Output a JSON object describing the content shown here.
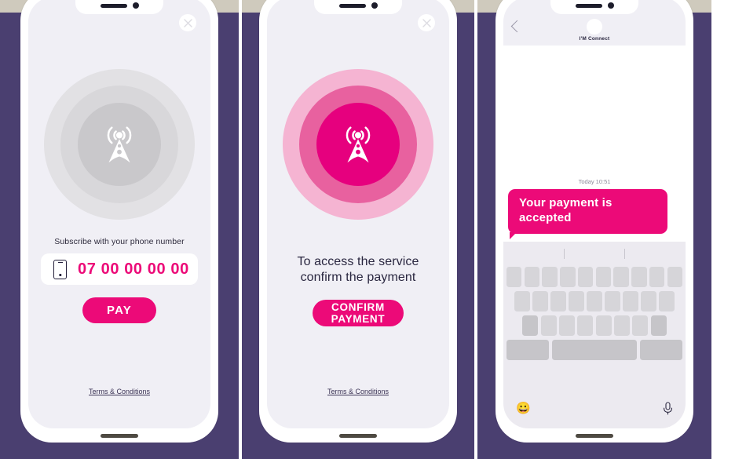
{
  "theme": {
    "background": "#4a3f70",
    "accent_pink": "#ec0a78",
    "screen_bg": "#f0eff5",
    "beige_strip": "#cfcabd"
  },
  "screens": [
    {
      "id": "subscribe",
      "close_icon": "close-icon",
      "graphic": {
        "icon": "radio-tower-icon",
        "variant": "grey"
      },
      "label": "Subscribe with your phone number",
      "phone_input": {
        "icon": "mobile-phone-icon",
        "value": "07 00 00 00 00",
        "placeholder": "07 00 00 00 00"
      },
      "primary_button": "PAY",
      "terms_link": "Terms & Conditions"
    },
    {
      "id": "confirm",
      "close_icon": "close-icon",
      "graphic": {
        "icon": "radio-tower-icon",
        "variant": "pink"
      },
      "title_line1": "To access the service",
      "title_line2": "confirm the payment",
      "primary_button": "CONFIRM PAYMENT",
      "terms_link": "Terms & Conditions"
    },
    {
      "id": "messages",
      "back_icon": "back-chevron-icon",
      "avatar": "contact-avatar",
      "contact_name": "I'M Connect",
      "timestamp": "Today 10:51",
      "message": "Your payment is accepted",
      "keyboard": {
        "row1_keys": 10,
        "row2_keys": 9,
        "row3_keys": 8,
        "emoji_icon": "emoji-icon",
        "mic_icon": "microphone-icon",
        "emoji_glyph": "😀"
      }
    }
  ]
}
